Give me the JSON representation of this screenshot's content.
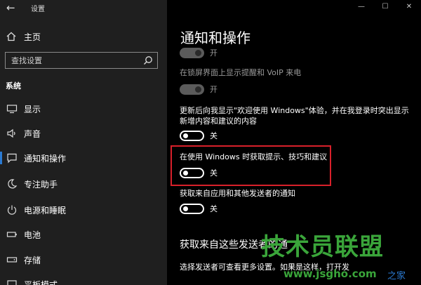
{
  "window": {
    "app_title": "设置",
    "controls": [
      "—",
      "☐",
      "✕"
    ]
  },
  "sidebar": {
    "home_label": "主页",
    "search": {
      "placeholder": "查找设置",
      "value": ""
    },
    "section_label": "系统",
    "items": [
      {
        "label": "显示",
        "icon": "display-icon"
      },
      {
        "label": "声音",
        "icon": "speaker-icon"
      },
      {
        "label": "通知和操作",
        "icon": "notification-icon",
        "active": true
      },
      {
        "label": "专注助手",
        "icon": "moon-icon"
      },
      {
        "label": "电源和睡眠",
        "icon": "power-icon"
      },
      {
        "label": "电池",
        "icon": "battery-icon"
      },
      {
        "label": "存储",
        "icon": "storage-icon"
      },
      {
        "label": "平板模式",
        "icon": "tablet-icon"
      }
    ]
  },
  "main": {
    "page_title": "通知和操作",
    "settings": [
      {
        "text": "",
        "toggle_label": "开",
        "state": "on",
        "disabled": true
      },
      {
        "text": "在锁屏界面上显示提醒和 VoIP 来电",
        "toggle_label": "开",
        "state": "on",
        "disabled": true
      },
      {
        "text": "更新后向我显示\"欢迎使用 Windows\"体验，并在我登录时突出显示新增内容和建议的内容",
        "toggle_label": "关",
        "state": "off"
      },
      {
        "text": "在使用 Windows 时获取提示、技巧和建议",
        "toggle_label": "关",
        "state": "off",
        "highlighted": true
      },
      {
        "text": "获取来自应用和其他发送者的通知",
        "toggle_label": "关",
        "state": "off"
      }
    ],
    "sub_heading": "获取来自这些发送者的通",
    "description": "选择发送者可查看更多设置。如果是这样，打开发"
  },
  "watermark": {
    "brand": "技术员联盟",
    "url": "www.jsgho.com",
    "tail": "之家"
  },
  "colors": {
    "accent": "#2b7ad1",
    "highlight_box": "#d8202a",
    "watermark": "#3aa53a"
  }
}
